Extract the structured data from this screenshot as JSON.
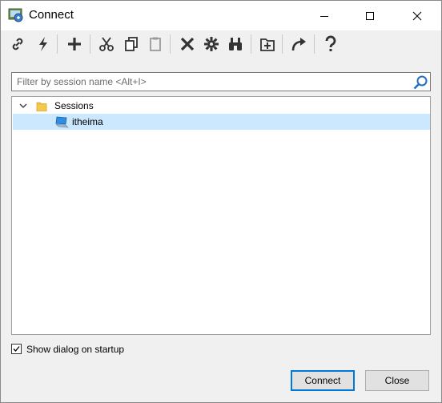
{
  "window": {
    "title": "Connect",
    "controls": {
      "minimize": "minimize",
      "maximize": "maximize",
      "close": "close"
    }
  },
  "toolbar": {
    "buttons": [
      {
        "name": "connect-link",
        "icon": "link-icon"
      },
      {
        "name": "quick-connect",
        "icon": "lightning-icon"
      },
      {
        "name": "new-session",
        "icon": "plus-icon"
      },
      {
        "name": "cut",
        "icon": "scissors-icon"
      },
      {
        "name": "copy",
        "icon": "copy-icon"
      },
      {
        "name": "paste",
        "icon": "clipboard-icon"
      },
      {
        "name": "delete",
        "icon": "x-icon"
      },
      {
        "name": "properties",
        "icon": "gear-icon"
      },
      {
        "name": "find",
        "icon": "binoculars-icon"
      },
      {
        "name": "new-folder",
        "icon": "folder-plus-icon"
      },
      {
        "name": "create-shortcut",
        "icon": "arrow-curve-icon"
      },
      {
        "name": "help",
        "icon": "question-icon"
      }
    ]
  },
  "filter": {
    "placeholder": "Filter by session name <Alt+I>",
    "value": ""
  },
  "tree": {
    "root": {
      "label": "Sessions",
      "expanded": true,
      "icon": "folder-icon"
    },
    "items": [
      {
        "label": "itheima",
        "icon": "computer-icon",
        "selected": true
      }
    ]
  },
  "startup_checkbox": {
    "label": "Show dialog on startup",
    "checked": true
  },
  "buttons": {
    "connect": "Connect",
    "close": "Close"
  },
  "colors": {
    "accent": "#0078d7",
    "selection": "#cce8ff",
    "folder": "#f5c94c"
  }
}
